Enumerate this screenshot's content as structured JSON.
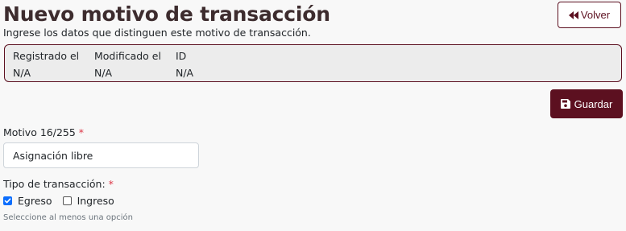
{
  "header": {
    "title": "Nuevo motivo de transacción",
    "subtitle": "Ingrese los datos que distinguen este motivo de transacción.",
    "back_label": "Volver"
  },
  "meta": {
    "registered_label": "Registrado el",
    "registered_value": "N/A",
    "modified_label": "Modificado el",
    "modified_value": "N/A",
    "id_label": "ID",
    "id_value": "N/A"
  },
  "actions": {
    "save_label": "Guardar"
  },
  "form": {
    "motivo": {
      "label": "Motivo 16/255",
      "required_mark": "*",
      "value": "Asignación libre"
    },
    "tipo": {
      "label": "Tipo de transacción:",
      "required_mark": "*",
      "options": [
        {
          "label": "Egreso",
          "checked": true
        },
        {
          "label": "Ingreso",
          "checked": false
        }
      ],
      "help": "Seleccione al menos una opción"
    }
  },
  "colors": {
    "brand": "#5c1020",
    "title": "#3d2c2e",
    "checkbox_checked": "#0d6efd",
    "required": "#dc3545"
  },
  "icons": {
    "back": "double-chevron-left-icon",
    "save": "floppy-disk-icon"
  }
}
